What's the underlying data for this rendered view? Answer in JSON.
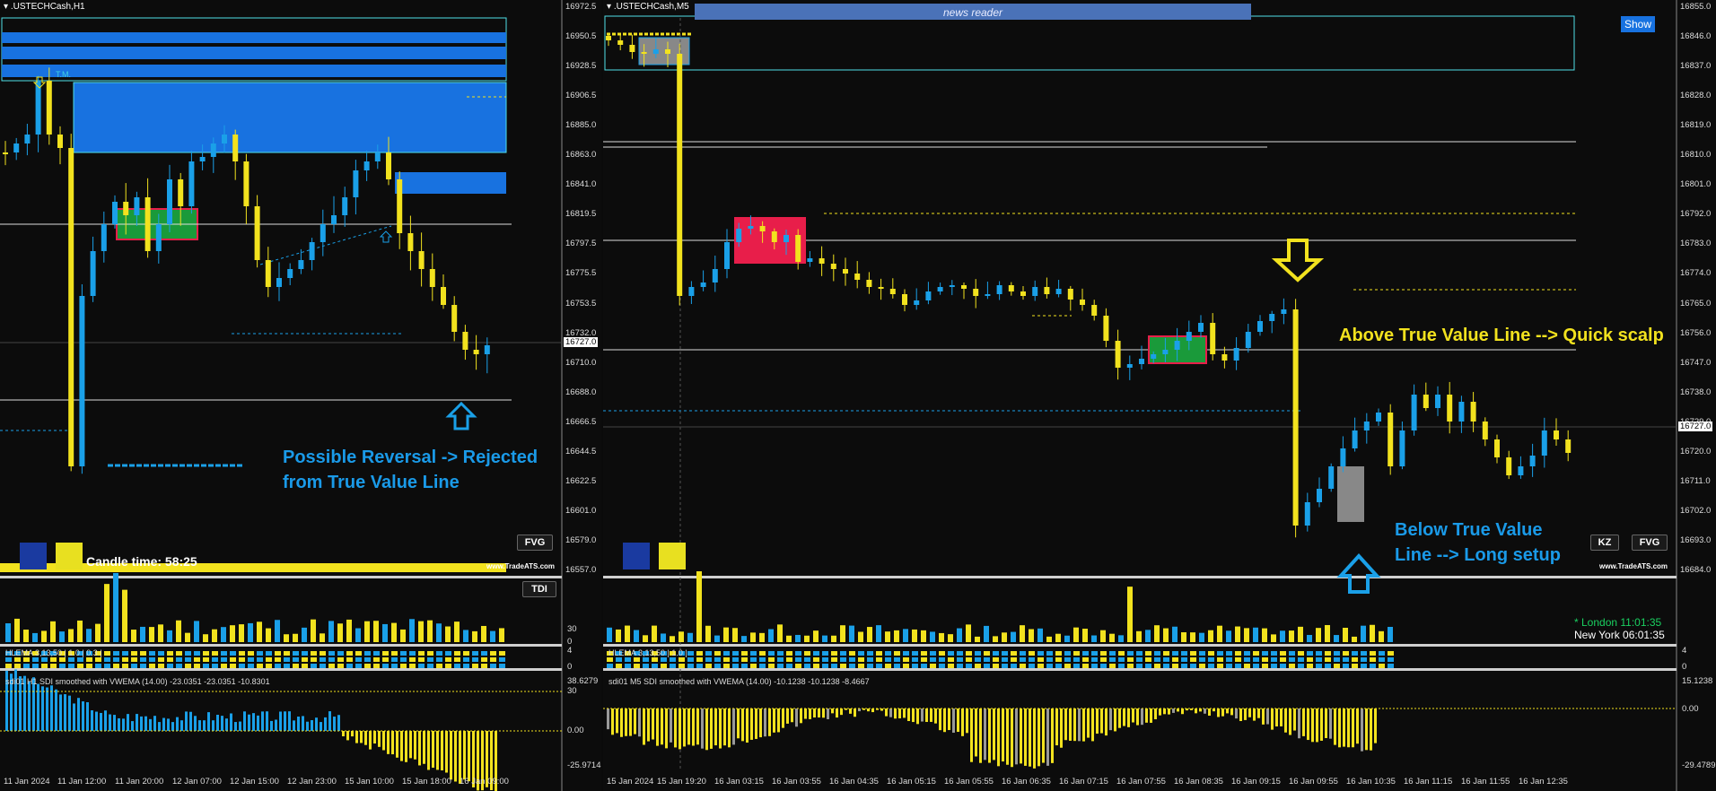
{
  "colors": {
    "bull": "#1aa0e8",
    "bear": "#f2e21e",
    "bg": "#0c0c0c",
    "zone_fill": "#1872e0",
    "zone_border": "#4fe0e8",
    "red_box": "#e81e4a",
    "green_box": "#1a9a3a",
    "annotation_blue": "#1a9ae8",
    "annotation_yellow": "#f2e21e"
  },
  "left": {
    "title": ".USTECHCash,H1",
    "price_ticks": [
      "16972.5",
      "16950.5",
      "16928.5",
      "16906.5",
      "16885.0",
      "16863.0",
      "16841.0",
      "16819.5",
      "16797.5",
      "16775.5",
      "16753.5",
      "16732.0",
      "16710.0",
      "16688.0",
      "16666.5",
      "16644.5",
      "16622.5",
      "16601.0",
      "16579.0",
      "16557.0"
    ],
    "current_price": "16727.0",
    "date_ticks": [
      "11 Jan 2024",
      "11 Jan 12:00",
      "11 Jan 20:00",
      "12 Jan 07:00",
      "12 Jan 15:00",
      "12 Jan 23:00",
      "15 Jan 10:00",
      "15 Jan 18:00",
      "16 Jan 09:00"
    ],
    "annotation": [
      "Possible Reversal -> Rejected",
      "from True Value Line"
    ],
    "candle_time": "Candle time:  58:25",
    "fvg_button": "FVG",
    "tdi_button": "TDI",
    "watermark": "www.TradeATS.com",
    "tag_label": "T.M.",
    "ind1_ticks": [
      "30",
      "0"
    ],
    "ind2_label": "HLEMA 3,13,50 | 1.0 | 0.3 |",
    "ind2_ticks": [
      "4",
      "0"
    ],
    "ind3_label": "sdi01 H1 SDI smoothed with VWEMA (14.00) -23.0351 -23.0351 -10.8301",
    "ind3_ticks": [
      "38.6279",
      "30",
      "0.00",
      "-25.9714"
    ]
  },
  "right": {
    "title": ".USTECHCash,M5",
    "news_reader": "news reader",
    "show_button": "Show",
    "price_ticks": [
      "16855.0",
      "16846.0",
      "16837.0",
      "16828.0",
      "16819.0",
      "16810.0",
      "16801.0",
      "16792.0",
      "16783.0",
      "16774.0",
      "16765.0",
      "16756.0",
      "16747.0",
      "16738.0",
      "16729.0",
      "16720.0",
      "16711.0",
      "16702.0",
      "16693.0",
      "16684.0"
    ],
    "current_price": "16727.0",
    "date_ticks": [
      "15 Jan 2024",
      "15 Jan 19:20",
      "16 Jan 03:15",
      "16 Jan 03:55",
      "16 Jan 04:35",
      "16 Jan 05:15",
      "16 Jan 05:55",
      "16 Jan 06:35",
      "16 Jan 07:15",
      "16 Jan 07:55",
      "16 Jan 08:35",
      "16 Jan 09:15",
      "16 Jan 09:55",
      "16 Jan 10:35",
      "16 Jan 11:15",
      "16 Jan 11:55",
      "16 Jan 12:35"
    ],
    "annotation_top": "Above True Value Line --> Quick scalp",
    "annotation_bottom": [
      "Below True Value",
      "Line --> Long setup"
    ],
    "kz_button": "KZ",
    "fvg_button": "FVG",
    "watermark": "www.TradeATS.com",
    "london_label": "* London   11:01:35",
    "newyork_label": "New York   06:01:35",
    "ind2_label": "HLEMA 3,13,50 | 1.0 |",
    "ind2_ticks": [
      "4",
      "0"
    ],
    "ind3_label": "sdi01 M5 SDI smoothed with VWEMA (14.00) -10.1238 -10.1238 -8.4667",
    "ind3_ticks": [
      "15.1238",
      "0.00",
      "-29.4789"
    ]
  }
}
